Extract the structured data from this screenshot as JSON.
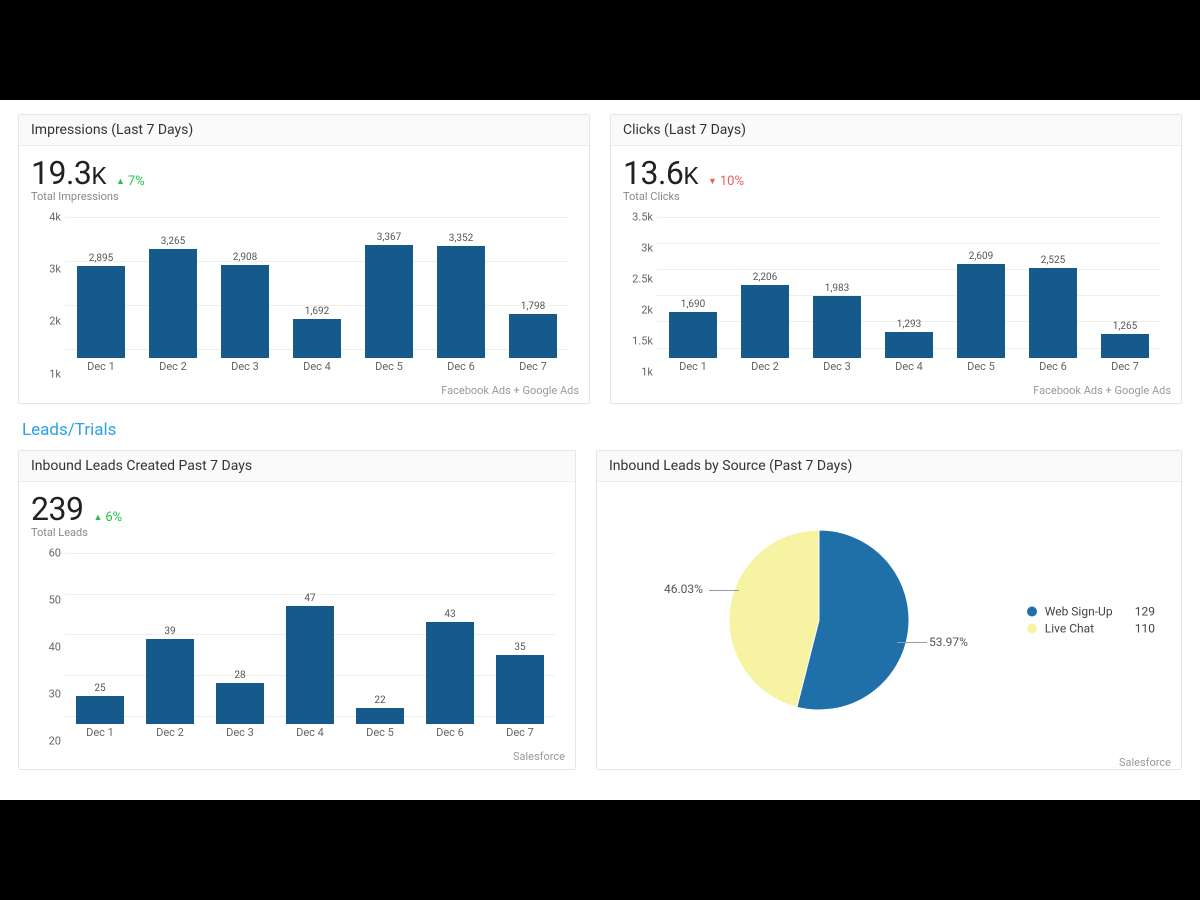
{
  "section_title": "Leads/Trials",
  "cards": {
    "impressions": {
      "title": "Impressions (Last 7 Days)",
      "metric": "19.3",
      "suffix": "K",
      "delta": "7%",
      "delta_dir": "up",
      "subtitle": "Total Impressions",
      "footer": "Facebook Ads + Google Ads"
    },
    "clicks": {
      "title": "Clicks (Last 7 Days)",
      "metric": "13.6",
      "suffix": "K",
      "delta": "10%",
      "delta_dir": "down",
      "subtitle": "Total Clicks",
      "footer": "Facebook Ads + Google Ads"
    },
    "leads": {
      "title": "Inbound Leads Created Past 7 Days",
      "metric": "239",
      "suffix": "",
      "delta": "6%",
      "delta_dir": "up",
      "subtitle": "Total Leads",
      "footer": "Salesforce"
    },
    "leads_source": {
      "title": "Inbound Leads by Source (Past 7 Days)",
      "footer": "Salesforce"
    }
  },
  "chart_data": [
    {
      "id": "impressions",
      "type": "bar",
      "categories": [
        "Dec 1",
        "Dec 2",
        "Dec 3",
        "Dec 4",
        "Dec 5",
        "Dec 6",
        "Dec 7"
      ],
      "values": [
        2895,
        3265,
        2908,
        1692,
        3367,
        3352,
        1798
      ],
      "value_labels": [
        "2,895",
        "3,265",
        "2,908",
        "1,692",
        "3,367",
        "3,352",
        "1,798"
      ],
      "yticks": [
        1000,
        2000,
        3000,
        4000
      ],
      "ytick_labels": [
        "1k",
        "2k",
        "3k",
        "4k"
      ],
      "ylim": [
        800,
        4000
      ],
      "title": "Impressions (Last 7 Days)"
    },
    {
      "id": "clicks",
      "type": "bar",
      "categories": [
        "Dec 1",
        "Dec 2",
        "Dec 3",
        "Dec 4",
        "Dec 5",
        "Dec 6",
        "Dec 7"
      ],
      "values": [
        1690,
        2206,
        1983,
        1293,
        2609,
        2525,
        1265
      ],
      "value_labels": [
        "1,690",
        "2,206",
        "1,983",
        "1,293",
        "2,609",
        "2,525",
        "1,265"
      ],
      "yticks": [
        1000,
        1500,
        2000,
        2500,
        3000,
        3500
      ],
      "ytick_labels": [
        "1k",
        "1.5k",
        "2k",
        "2.5k",
        "3k",
        "3.5k"
      ],
      "ylim": [
        800,
        3500
      ],
      "title": "Clicks (Last 7 Days)"
    },
    {
      "id": "leads",
      "type": "bar",
      "categories": [
        "Dec 1",
        "Dec 2",
        "Dec 3",
        "Dec 4",
        "Dec 5",
        "Dec 6",
        "Dec 7"
      ],
      "values": [
        25,
        39,
        28,
        47,
        22,
        43,
        35
      ],
      "value_labels": [
        "25",
        "39",
        "28",
        "47",
        "22",
        "43",
        "35"
      ],
      "yticks": [
        20,
        30,
        40,
        50,
        60
      ],
      "ytick_labels": [
        "20",
        "30",
        "40",
        "50",
        "60"
      ],
      "ylim": [
        18,
        60
      ],
      "title": "Inbound Leads Created Past 7 Days"
    },
    {
      "id": "leads_source",
      "type": "pie",
      "title": "Inbound Leads by Source (Past 7 Days)",
      "series": [
        {
          "name": "Web Sign-Up",
          "value": 129,
          "pct": 53.97,
          "pct_label": "53.97%",
          "color": "#1f6fa8"
        },
        {
          "name": "Live Chat",
          "value": 110,
          "pct": 46.03,
          "pct_label": "46.03%",
          "color": "#f6f3a2"
        }
      ]
    }
  ]
}
